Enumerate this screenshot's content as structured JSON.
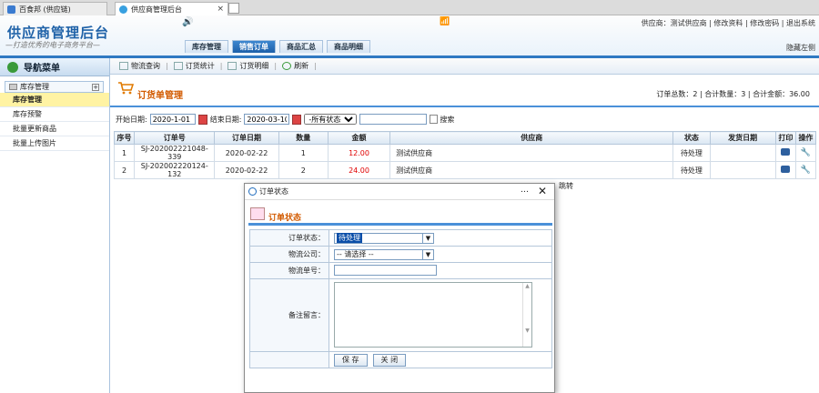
{
  "browser": {
    "tabs": [
      {
        "label": "百食邦 (供应链)",
        "active": false
      },
      {
        "label": "供应商管理后台",
        "active": true
      }
    ],
    "close": "×"
  },
  "header": {
    "title": "供应商管理后台",
    "slogan": "—打造优秀的电子商务平台—",
    "links": "供应商：测试供应商 | 修改资料 | 修改密码 | 退出系统",
    "hide_left": "隐藏左侧",
    "speaker": "🔊",
    "wifi": "📶",
    "nav": [
      {
        "label": "库存管理",
        "active": false
      },
      {
        "label": "销售订单",
        "active": true
      },
      {
        "label": "商品汇总",
        "active": false
      },
      {
        "label": "商品明细",
        "active": false
      }
    ]
  },
  "sidebar": {
    "title": "导航菜单",
    "group": "库存管理",
    "items": [
      {
        "label": "库存管理",
        "active": true
      },
      {
        "label": "库存预警",
        "active": false
      },
      {
        "label": "批量更新商品",
        "active": false
      },
      {
        "label": "批量上传图片",
        "active": false
      }
    ]
  },
  "toolbar": {
    "items": [
      "物流查询",
      "订货统计",
      "订货明细",
      "刷新"
    ]
  },
  "page": {
    "title": "订货单管理",
    "stats": "订单总数：2 | 合计数量：3 | 合计金额：36.00"
  },
  "filter": {
    "start_label": "开始日期:",
    "start": "2020-1-01",
    "end_label": "结束日期:",
    "end": "2020-03-10",
    "status": "-所有状态-",
    "search_label": "搜索"
  },
  "table": {
    "headers": [
      "序号",
      "订单号",
      "订单日期",
      "数量",
      "金额",
      "供应商",
      "状态",
      "发货日期",
      "打印",
      "操作"
    ],
    "rows": [
      [
        "1",
        "SJ-202002221048-339",
        "2020-02-22",
        "1",
        "12.00",
        "测试供应商",
        "待处理",
        ""
      ],
      [
        "2",
        "SJ-202002220124-132",
        "2020-02-22",
        "2",
        "24.00",
        "测试供应商",
        "待处理",
        ""
      ]
    ]
  },
  "pager": {
    "jump": "跳转"
  },
  "dialog": {
    "title": "订单状态",
    "minimize": "…",
    "close": "✕",
    "heading": "订单状态",
    "fields": {
      "status_label": "订单状态：",
      "status_value": "待处理",
      "logistics_label": "物流公司：",
      "logistics_value": "-- 请选择 --",
      "number_label": "物流单号：",
      "note_label": "备注留言："
    },
    "save": "保 存",
    "close_btn": "关 闭"
  }
}
